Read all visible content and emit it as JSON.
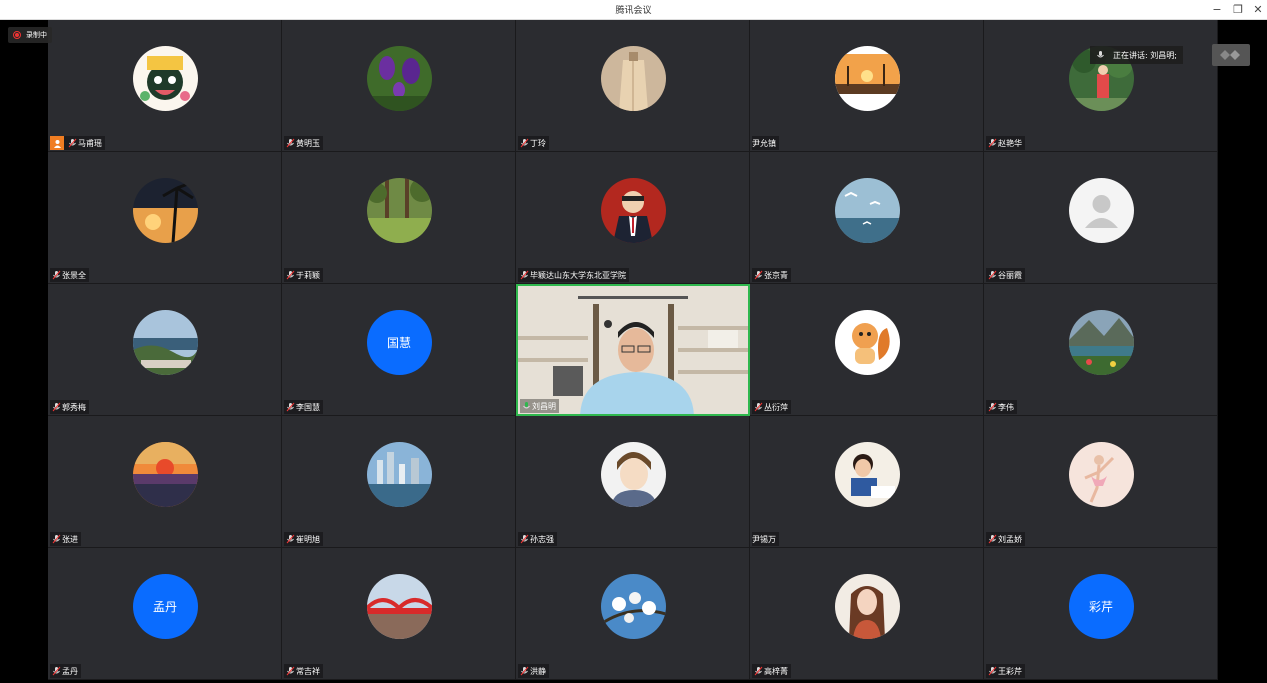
{
  "window": {
    "title": "腾讯会议"
  },
  "recording": {
    "label": "录制中"
  },
  "speaking": {
    "label": "正在讲话: 刘昌明;"
  },
  "participants": [
    {
      "name": "马甫瑶",
      "avatar": "cartoon-girl",
      "host": true
    },
    {
      "name": "黄明玉",
      "avatar": "purple-iris"
    },
    {
      "name": "丁玲",
      "avatar": "beige-coat"
    },
    {
      "name": "尹允镇",
      "avatar": "sunset-dock",
      "muted_icon": false
    },
    {
      "name": "赵艳华",
      "avatar": "girl-red-dress"
    },
    {
      "name": "张景全",
      "avatar": "palm-sunset"
    },
    {
      "name": "于莉颖",
      "avatar": "forest-trees"
    },
    {
      "name": "毕颖达山东大学东北亚学院",
      "avatar": "cartoon-man-suit"
    },
    {
      "name": "张京青",
      "avatar": "seagulls-sea"
    },
    {
      "name": "谷丽霞",
      "avatar": "default-person"
    },
    {
      "name": "郭秀梅",
      "avatar": "coast-landscape"
    },
    {
      "name": "李国慧",
      "avatar_text": "国慧"
    },
    {
      "name": "刘昌明",
      "video": true,
      "speaking": true
    },
    {
      "name": "丛衍萍",
      "avatar": "cartoon-squirrel"
    },
    {
      "name": "李伟",
      "avatar": "mountain-lake"
    },
    {
      "name": "张进",
      "avatar": "sunset-city"
    },
    {
      "name": "崔明旭",
      "avatar": "city-skyline"
    },
    {
      "name": "孙志强",
      "avatar": "anime-boy"
    },
    {
      "name": "尹锡万",
      "avatar": "child-drawing",
      "muted_icon": false
    },
    {
      "name": "刘孟娇",
      "avatar": "ballerina"
    },
    {
      "name": "孟丹",
      "avatar_text": "孟丹"
    },
    {
      "name": "常吉祥",
      "avatar": "red-bridge"
    },
    {
      "name": "洪静",
      "avatar": "white-flowers"
    },
    {
      "name": "高梓菁",
      "avatar": "woman-portrait"
    },
    {
      "name": "王彩芹",
      "avatar_text": "彩芹"
    }
  ]
}
